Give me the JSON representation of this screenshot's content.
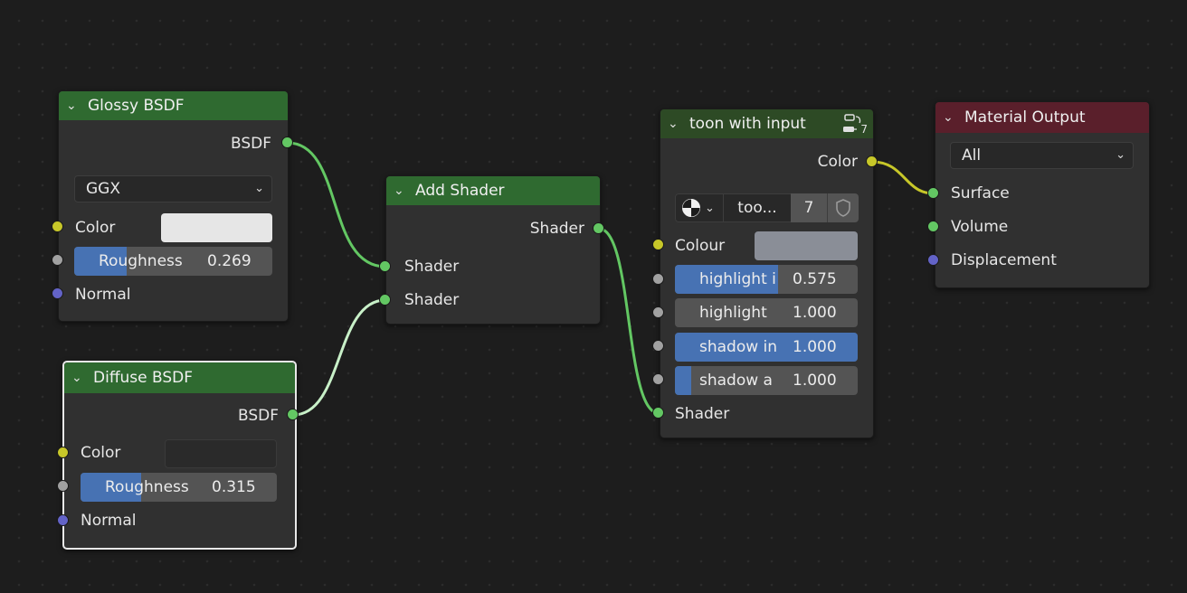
{
  "nodes": {
    "glossy": {
      "title": "Glossy BSDF",
      "output": "BSDF",
      "distribution": "GGX",
      "color_label": "Color",
      "color_value": "#e6e6e6",
      "roughness_label": "Roughness",
      "roughness_value": "0.269",
      "roughness_fraction": 0.269,
      "normal_label": "Normal"
    },
    "diffuse": {
      "title": "Diffuse BSDF",
      "output": "BSDF",
      "color_label": "Color",
      "color_value": "#2a2a2a",
      "roughness_label": "Roughness",
      "roughness_value": "0.315",
      "roughness_fraction": 0.315,
      "normal_label": "Normal"
    },
    "add_shader": {
      "title": "Add Shader",
      "output": "Shader",
      "input1": "Shader",
      "input2": "Shader"
    },
    "toon": {
      "title": "toon with input",
      "group_users_badge": "7",
      "output": "Color",
      "group_name": "too...",
      "group_users": "7",
      "colour_label": "Colour",
      "colour_value": "#8a8e97",
      "inputs": [
        {
          "label": "highlight i",
          "value": "0.575",
          "fraction": 0.575
        },
        {
          "label": "highlight",
          "value": "1.000",
          "fraction": 0.0
        },
        {
          "label": "shadow in",
          "value": "1.000",
          "fraction": 1.0
        },
        {
          "label": "shadow a",
          "value": "1.000",
          "fraction": 0.09
        }
      ],
      "shader_label": "Shader"
    },
    "material_output": {
      "title": "Material Output",
      "target": "All",
      "surface": "Surface",
      "volume": "Volume",
      "displacement": "Displacement"
    }
  },
  "colors": {
    "link_green": "#63c763",
    "link_light": "#c8f0c8",
    "link_yellow": "#c7c729",
    "slider_fill": "#4772b3"
  },
  "icons": {
    "chevron": "chevron-down-icon",
    "group": "node-group-icon",
    "sphere": "material-sphere-icon",
    "fake_user": "shield-icon"
  }
}
